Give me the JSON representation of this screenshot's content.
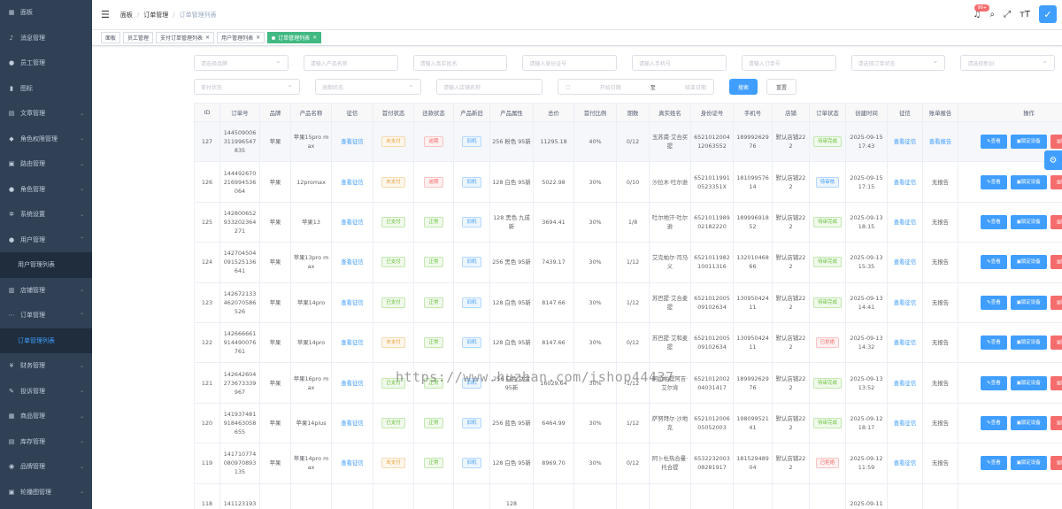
{
  "sidebar": {
    "items": [
      {
        "icon": "dashboard-icon",
        "glyph": "▦",
        "label": "面板",
        "arrow": ""
      },
      {
        "icon": "bell-icon",
        "glyph": "♪",
        "label": "消息管理",
        "arrow": ""
      },
      {
        "icon": "user-icon",
        "glyph": "●",
        "label": "员工管理",
        "arrow": ""
      },
      {
        "icon": "chart-icon",
        "glyph": "▮",
        "label": "图标",
        "arrow": ""
      },
      {
        "icon": "document-icon",
        "glyph": "▤",
        "label": "文章管理",
        "arrow": "⌄"
      },
      {
        "icon": "role-icon",
        "glyph": "◆",
        "label": "角色权限管理",
        "arrow": "⌄"
      },
      {
        "icon": "route-icon",
        "glyph": "▣",
        "label": "路由管理",
        "arrow": "⌄"
      },
      {
        "icon": "person-icon",
        "glyph": "●",
        "label": "角色管理",
        "arrow": "⌄"
      },
      {
        "icon": "gear-icon",
        "glyph": "✲",
        "label": "系统设置",
        "arrow": "⌄"
      },
      {
        "icon": "user-group-icon",
        "glyph": "●",
        "label": "用户管理",
        "arrow": "⌃"
      },
      {
        "icon": "",
        "glyph": "",
        "label": "用户管理列表",
        "arrow": "",
        "sub": true
      },
      {
        "icon": "shop-icon",
        "glyph": "▥",
        "label": "店铺管理",
        "arrow": "⌄"
      },
      {
        "icon": "more-icon",
        "glyph": "⋯",
        "label": "订单管理",
        "arrow": "⌃"
      },
      {
        "icon": "",
        "glyph": "",
        "label": "订单管理列表",
        "arrow": "",
        "sub": true,
        "active": true
      },
      {
        "icon": "money-icon",
        "glyph": "¥",
        "label": "财务管理",
        "arrow": "⌄"
      },
      {
        "icon": "complaint-icon",
        "glyph": "✎",
        "label": "投诉管理",
        "arrow": "⌄"
      },
      {
        "icon": "goods-icon",
        "glyph": "▦",
        "label": "商品管理",
        "arrow": "⌄"
      },
      {
        "icon": "stock-icon",
        "glyph": "▤",
        "label": "库存管理",
        "arrow": "⌄"
      },
      {
        "icon": "brand-icon",
        "glyph": "◉",
        "label": "品牌管理",
        "arrow": "⌄"
      },
      {
        "icon": "carousel-icon",
        "glyph": "▣",
        "label": "轮播图管理",
        "arrow": "⌄"
      }
    ]
  },
  "navbar": {
    "breadcrumb": [
      "面板",
      "订单管理",
      "订单管理列表"
    ],
    "badge": "99+"
  },
  "tags": [
    {
      "label": "面板",
      "closable": false
    },
    {
      "label": "员工管理",
      "closable": false
    },
    {
      "label": "支付订单管理列表",
      "closable": true
    },
    {
      "label": "用户管理列表",
      "closable": true
    },
    {
      "label": "订单管理列表",
      "closable": true,
      "active": true
    }
  ],
  "filters": {
    "row1": [
      {
        "ph": "请选择品牌",
        "sel": true
      },
      {
        "ph": "请输入产品名称"
      },
      {
        "ph": "请输入真实姓名"
      },
      {
        "ph": "请输入身份证号"
      },
      {
        "ph": "请输入手机号"
      },
      {
        "ph": "请输入订单号"
      },
      {
        "ph": "请选择订单状态",
        "sel": true
      },
      {
        "ph": "请选择新旧",
        "sel": true
      }
    ],
    "row2": [
      {
        "ph": "首付状态",
        "sel": true
      },
      {
        "ph": "逾期状态",
        "sel": true
      },
      {
        "ph": "请输入店铺名称"
      }
    ],
    "date_start": "开始日期",
    "date_to": "至",
    "date_end": "结束日期",
    "search_label": "搜索",
    "reset_label": "重置"
  },
  "table": {
    "headers": [
      "ID",
      "订单号",
      "品牌",
      "产品名称",
      "征信",
      "首付状态",
      "还款状态",
      "产品新旧",
      "产品属性",
      "总价",
      "首付比例",
      "期数",
      "真实姓名",
      "身份证号",
      "手机号",
      "店铺",
      "订单状态",
      "创建时间",
      "征信",
      "账单报告",
      "操作"
    ],
    "rows": [
      {
        "id": "127",
        "order": "144509006311996547835",
        "brand": "苹果",
        "product": "苹果15pro max",
        "credit": "查看征信",
        "pay": "未支付",
        "payc": "orange",
        "repay": "逾期",
        "repayc": "red",
        "cond": "旧机",
        "attr": "256 粉色 95新",
        "total": "11295.18",
        "ratio": "40%",
        "term": "0/12",
        "name": "玉苏甫·艾合买提",
        "idno": "652101200412063552",
        "phone": "18999262976",
        "shop": "默认店铺222",
        "status": "待审完成",
        "statusc": "green",
        "time": "2025-09-15 17:43",
        "credit2": "查看征信",
        "report": "查看报告",
        "reportlink": true
      },
      {
        "id": "126",
        "order": "144492670216994536064",
        "brand": "苹果",
        "product": "12promax",
        "credit": "查看征信",
        "pay": "未支付",
        "payc": "orange",
        "repay": "逾期",
        "repayc": "red",
        "cond": "旧机",
        "attr": "128 白色 95新",
        "total": "5022.98",
        "ratio": "30%",
        "term": "0/10",
        "name": "沙拉木·吐尔逊",
        "idno": "65210119910523351X",
        "phone": "18109957614",
        "shop": "默认店铺222",
        "status": "待审核",
        "statusc": "blue",
        "time": "2025-09-15 17:15",
        "credit2": "查看征信",
        "report": "无报告"
      },
      {
        "id": "125",
        "order": "142800652933202364271",
        "brand": "苹果",
        "product": "苹果13",
        "credit": "查看征信",
        "pay": "已支付",
        "payc": "green",
        "repay": "正常",
        "repayc": "green",
        "cond": "旧机",
        "attr": "128 黑色 九成新",
        "total": "3694.41",
        "ratio": "30%",
        "term": "1/8",
        "name": "吐尔地汗·吐尔逊",
        "idno": "652101198902182220",
        "phone": "18999691852",
        "shop": "默认店铺222",
        "status": "待审完成",
        "statusc": "green",
        "time": "2025-09-13 18:15",
        "credit2": "查看征信",
        "report": "无报告"
      },
      {
        "id": "124",
        "order": "142704504091525136641",
        "brand": "苹果",
        "product": "苹果13pro max",
        "credit": "查看征信",
        "pay": "已支付",
        "payc": "green",
        "repay": "正常",
        "repayc": "green",
        "cond": "旧机",
        "attr": "256 黑色 95新",
        "total": "7439.17",
        "ratio": "30%",
        "term": "1/12",
        "name": "艾克帕尔·司马义",
        "idno": "652101198210011316",
        "phone": "13201046866",
        "shop": "默认店铺222",
        "status": "待审完成",
        "statusc": "green",
        "time": "2025-09-13 15:35",
        "credit2": "查看征信",
        "report": "无报告"
      },
      {
        "id": "123",
        "order": "142672133462070586526",
        "brand": "苹果",
        "product": "苹果14pro",
        "credit": "查看征信",
        "pay": "已支付",
        "payc": "green",
        "repay": "正常",
        "repayc": "green",
        "cond": "旧机",
        "attr": "128 白色 95新",
        "total": "8147.66",
        "ratio": "30%",
        "term": "1/12",
        "name": "苏巴提·艾合麦提",
        "idno": "652101200509102634",
        "phone": "13095042411",
        "shop": "默认店铺222",
        "status": "待审完成",
        "statusc": "green",
        "time": "2025-09-13 14:41",
        "credit2": "查看征信",
        "report": "无报告"
      },
      {
        "id": "122",
        "order": "142666661914490076761",
        "brand": "苹果",
        "product": "苹果14pro",
        "credit": "查看征信",
        "pay": "未支付",
        "payc": "orange",
        "repay": "正常",
        "repayc": "green",
        "cond": "旧机",
        "attr": "128 白色 95新",
        "total": "8147.66",
        "ratio": "30%",
        "term": "0/12",
        "name": "苏巴提·艾和麦提",
        "idno": "652101200509102634",
        "phone": "13095042411",
        "shop": "默认店铺222",
        "status": "已拒绝",
        "statusc": "red",
        "time": "2025-09-13 14:32",
        "credit2": "查看征信",
        "report": "无报告"
      },
      {
        "id": "121",
        "order": "142642604273673339967",
        "brand": "苹果",
        "product": "苹果16pro max",
        "credit": "查看征信",
        "pay": "已支付",
        "payc": "green",
        "repay": "正常",
        "repayc": "green",
        "cond": "旧机",
        "attr": "256 白色 钛金 95新",
        "total": "16029.64",
        "ratio": "30%",
        "term": "1/12",
        "name": "阿拉帕提阿吉·艾尔肯",
        "idno": "652101200204031417",
        "phone": "18999262976",
        "shop": "默认店铺222",
        "status": "待审完成",
        "statusc": "green",
        "time": "2025-09-13 13:52",
        "credit2": "查看征信",
        "report": "无报告"
      },
      {
        "id": "120",
        "order": "141937481918463058655",
        "brand": "苹果",
        "product": "苹果14plus",
        "credit": "查看征信",
        "pay": "已支付",
        "payc": "green",
        "repay": "正常",
        "repayc": "green",
        "cond": "旧机",
        "attr": "256 蓝色 95新",
        "total": "6464.99",
        "ratio": "30%",
        "term": "1/12",
        "name": "萨努拜尔·沙地克",
        "idno": "652101200605052003",
        "phone": "19809952141",
        "shop": "默认店铺222",
        "status": "待审完成",
        "statusc": "green",
        "time": "2025-09-12 18:17",
        "credit2": "查看征信",
        "report": "无报告"
      },
      {
        "id": "119",
        "order": "141710774080970893135",
        "brand": "苹果",
        "product": "苹果14pro max",
        "credit": "查看征信",
        "pay": "未支付",
        "payc": "orange",
        "repay": "正常",
        "repayc": "green",
        "cond": "旧机",
        "attr": "128 白色 95新",
        "total": "8969.70",
        "ratio": "30%",
        "term": "0/12",
        "name": "阿卜杜热合曼·托合提",
        "idno": "653223200308281917",
        "phone": "18152948904",
        "shop": "默认店铺222",
        "status": "已拒绝",
        "statusc": "red",
        "time": "2025-09-12 11:59",
        "credit2": "查看征信",
        "report": "无报告"
      },
      {
        "id": "118",
        "order": "141123193",
        "brand": "",
        "product": "",
        "credit": "",
        "pay": "",
        "repay": "",
        "cond": "",
        "attr": "128",
        "total": "",
        "ratio": "",
        "term": "",
        "name": "",
        "idno": "",
        "phone": "",
        "shop": "",
        "status": "",
        "time": "2025-09-11",
        "credit2": "",
        "report": "",
        "partial": true
      }
    ],
    "ops": {
      "view": "查看",
      "lock": "锁定设备",
      "del": "删除"
    }
  },
  "watermark": "https://www.huzhan.com/ishop44437"
}
